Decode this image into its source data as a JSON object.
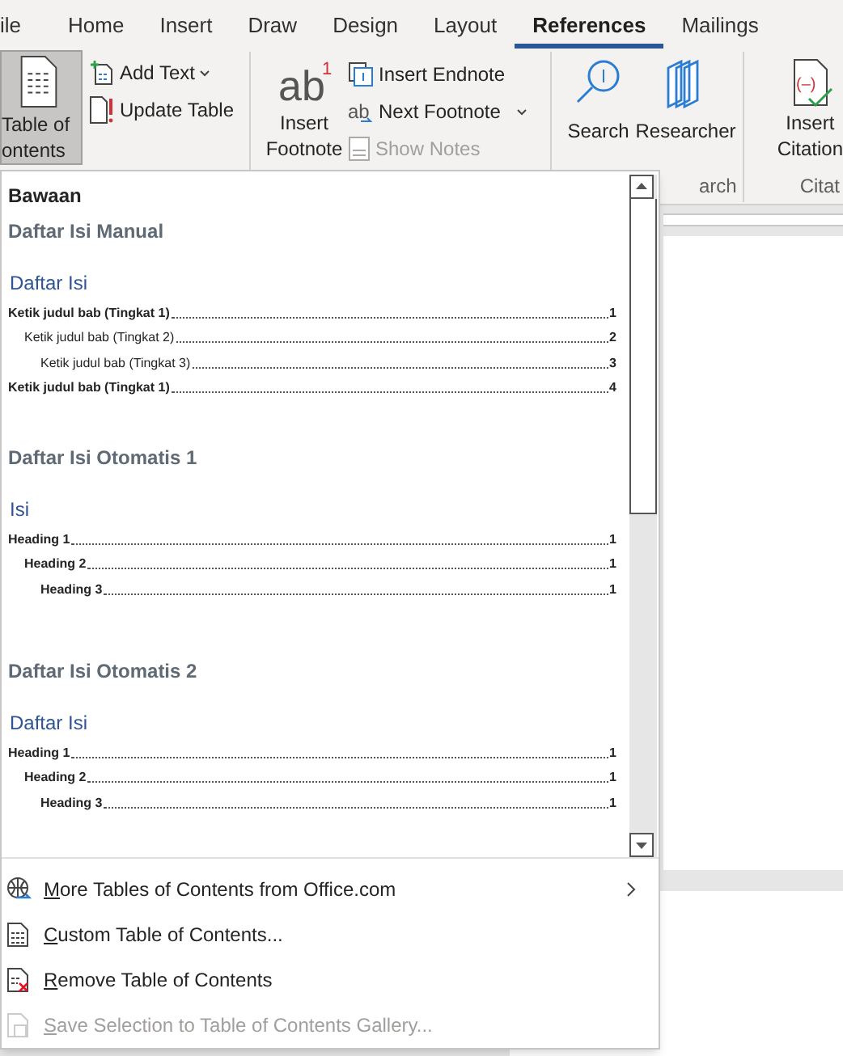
{
  "tabs": [
    {
      "label": "ile",
      "selected": false
    },
    {
      "label": "Home",
      "selected": false
    },
    {
      "label": "Insert",
      "selected": false
    },
    {
      "label": "Draw",
      "selected": false
    },
    {
      "label": "Design",
      "selected": false
    },
    {
      "label": "Layout",
      "selected": false
    },
    {
      "label": "References",
      "selected": true
    },
    {
      "label": "Mailings",
      "selected": false
    }
  ],
  "ribbon": {
    "toc_button": {
      "lines": [
        "Table of",
        "ontents"
      ],
      "pressed": true
    },
    "add_text": "Add Text",
    "update_table": "Update Table",
    "footnote_icon": {
      "letters": "ab",
      "number": "1"
    },
    "next_footnote_icon": "ab",
    "citation_icon": "(–)",
    "insert_footnote": [
      "Insert",
      "Footnote"
    ],
    "insert_endnote": "Insert Endnote",
    "next_footnote": "Next Footnote",
    "show_notes": {
      "label": "Show Notes",
      "disabled": true
    },
    "search": "Search",
    "researcher": "Researcher",
    "insert_citation": [
      "Insert",
      "Citation"
    ],
    "group_labels": [
      "arch",
      "Citat"
    ]
  },
  "menu": {
    "header": "Bawaan",
    "gallery": [
      {
        "title": "Daftar Isi Manual",
        "heading": "Daftar Isi",
        "entries": [
          {
            "text": "Ketik judul bab (Tingkat 1)",
            "page": "1",
            "bold": true,
            "children": [
              {
                "text": "Ketik judul bab (Tingkat 2)",
                "page": "2",
                "bold": false,
                "children": [
                  {
                    "text": "Ketik judul bab (Tingkat 3)",
                    "page": "3",
                    "bold": false
                  }
                ]
              }
            ]
          },
          {
            "text": "Ketik judul bab (Tingkat 1)",
            "page": "4",
            "bold": true
          }
        ]
      },
      {
        "title": "Daftar Isi Otomatis 1",
        "heading": "Isi",
        "entries": [
          {
            "text": "Heading 1",
            "page": "1",
            "bold": true,
            "children": [
              {
                "text": "Heading 2",
                "page": "1",
                "bold": true,
                "children": [
                  {
                    "text": "Heading 3",
                    "page": "1",
                    "bold": true
                  }
                ]
              }
            ]
          }
        ]
      },
      {
        "title": "Daftar Isi Otomatis 2",
        "heading": "Daftar Isi",
        "entries": [
          {
            "text": "Heading 1",
            "page": "1",
            "bold": true,
            "children": [
              {
                "text": "Heading 2",
                "page": "1",
                "bold": true,
                "children": [
                  {
                    "text": "Heading 3",
                    "page": "1",
                    "bold": true
                  }
                ]
              }
            ]
          }
        ]
      }
    ],
    "items": [
      {
        "kind": "globe",
        "label": "More Tables of Contents from Office.com",
        "submenu": true,
        "disabled": false
      },
      {
        "kind": "custom",
        "label": "Custom Table of Contents...",
        "submenu": false,
        "disabled": false
      },
      {
        "kind": "remove",
        "label": "Remove Table of Contents",
        "submenu": false,
        "disabled": false
      },
      {
        "kind": "save",
        "label": "Save Selection to Table of Contents Gallery...",
        "submenu": false,
        "disabled": true
      }
    ]
  }
}
